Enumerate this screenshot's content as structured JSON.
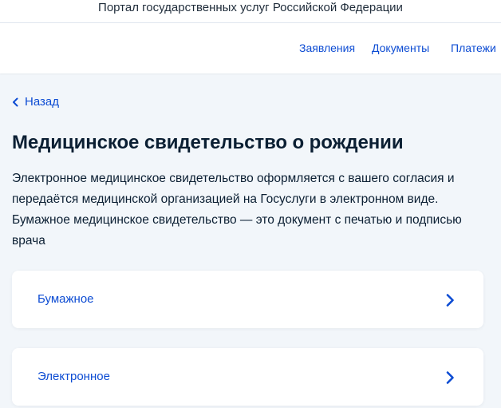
{
  "header": {
    "portal_title": "Портал государственных услуг Российской Федерации"
  },
  "nav": {
    "items": [
      {
        "label": "Заявления"
      },
      {
        "label": "Документы"
      },
      {
        "label": "Платежи"
      }
    ]
  },
  "back": {
    "label": "Назад",
    "icon": "chevron-left-icon"
  },
  "main": {
    "title": "Медицинское свидетельство о рождении",
    "description": "Электронное медицинское свидетельство оформляется с вашего согласия и передаётся медицинской организацией на Госуслуги в электронном виде. Бумажное медицинское свидетельство — это документ с печатью и подписью врача",
    "options": [
      {
        "label": "Бумажное",
        "icon": "chevron-right-icon"
      },
      {
        "label": "Электронное",
        "icon": "chevron-right-icon"
      }
    ]
  },
  "colors": {
    "accent": "#0d4cd3",
    "background": "#f2f6fa",
    "text": "#0b1f33"
  }
}
